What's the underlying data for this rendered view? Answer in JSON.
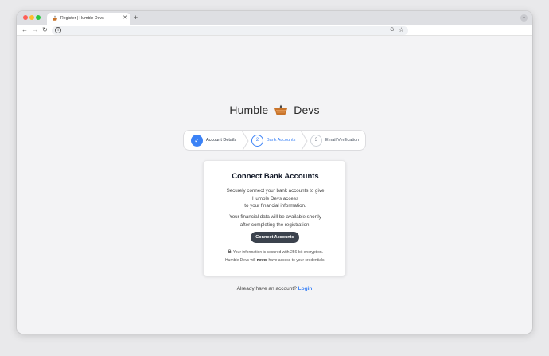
{
  "browser": {
    "tab_title": "Register | Humble Devs",
    "tab_close": "✕",
    "new_tab": "+",
    "tab_menu": "⌄",
    "nav": {
      "back": "←",
      "forward": "→",
      "reload": "↻"
    },
    "site_info": "i",
    "omnibox_value": "",
    "icons": [
      "back-arrow-icon",
      "forward-arrow-icon",
      "reload-icon",
      "site-info-icon",
      "translate-icon",
      "bookmark-star-icon"
    ],
    "translate": "G",
    "bookmark": "☆"
  },
  "brand": {
    "left": "Humble",
    "right": "Devs",
    "logo_color": "#c9742a"
  },
  "stepper": {
    "steps": [
      {
        "index": "✓",
        "label": "Account Details",
        "state": "complete"
      },
      {
        "index": "2",
        "label": "Bank Accounts",
        "state": "active"
      },
      {
        "index": "3",
        "label": "Email Verification",
        "state": "upcoming"
      }
    ],
    "accent": "#3b82f6"
  },
  "card": {
    "title": "Connect Bank Accounts",
    "para1": [
      "Securely connect your bank accounts to give",
      "Humble Devs access",
      "to your financial information."
    ],
    "para2": [
      "Your financial data will be available shortly",
      "after completing the registration."
    ],
    "button": "Connect Accounts",
    "secure_note": "Your information is secured with 256-bit encryption.",
    "never_prefix": "Humble Devs will",
    "never_word": "never",
    "never_suffix": "have access to your credentials."
  },
  "footer": {
    "prompt": "Already have an account?",
    "login": "Login"
  }
}
